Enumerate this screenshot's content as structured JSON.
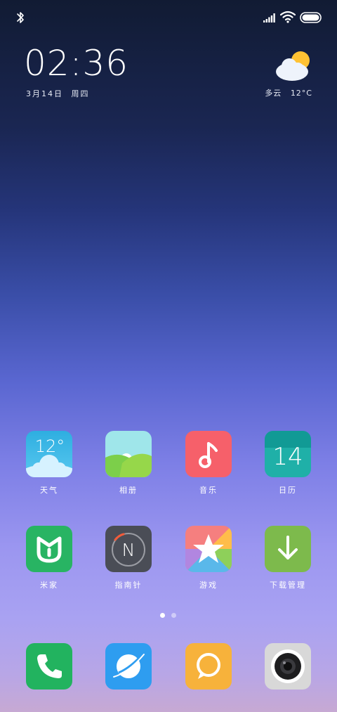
{
  "status_bar": {
    "icons": [
      "bluetooth-icon",
      "signal-icon",
      "wifi-icon",
      "battery-icon"
    ]
  },
  "clock": {
    "time": "02:36",
    "date": "3月14日",
    "weekday": "周四"
  },
  "weather_widget": {
    "icon": "partly-cloudy-icon",
    "condition": "多云",
    "temperature": "12°C"
  },
  "apps": [
    {
      "label": "天气",
      "icon": "weather-icon",
      "tile_text": "12°",
      "color": "#3bb4e6"
    },
    {
      "label": "相册",
      "icon": "gallery-icon",
      "color": "#8fe0e4"
    },
    {
      "label": "音乐",
      "icon": "music-icon",
      "color": "#f6606a"
    },
    {
      "label": "日历",
      "icon": "calendar-icon",
      "tile_text": "14",
      "color": "#1fb0a8"
    },
    {
      "label": "米家",
      "icon": "mi-home-icon",
      "color": "#28b463"
    },
    {
      "label": "指南针",
      "icon": "compass-icon",
      "tile_text": "N",
      "color": "#4a4d56"
    },
    {
      "label": "游戏",
      "icon": "games-icon",
      "color": "#f57f7f"
    },
    {
      "label": "下载管理",
      "icon": "download-icon",
      "color": "#7dba4c"
    }
  ],
  "page_indicator": {
    "current": 1,
    "total": 2
  },
  "dock": [
    {
      "icon": "phone-icon",
      "color": "#22b35f"
    },
    {
      "icon": "browser-icon",
      "color": "#2e9df0"
    },
    {
      "icon": "messages-icon",
      "color": "#f7b23b"
    },
    {
      "icon": "camera-icon",
      "color": "#d8d8d8"
    }
  ]
}
